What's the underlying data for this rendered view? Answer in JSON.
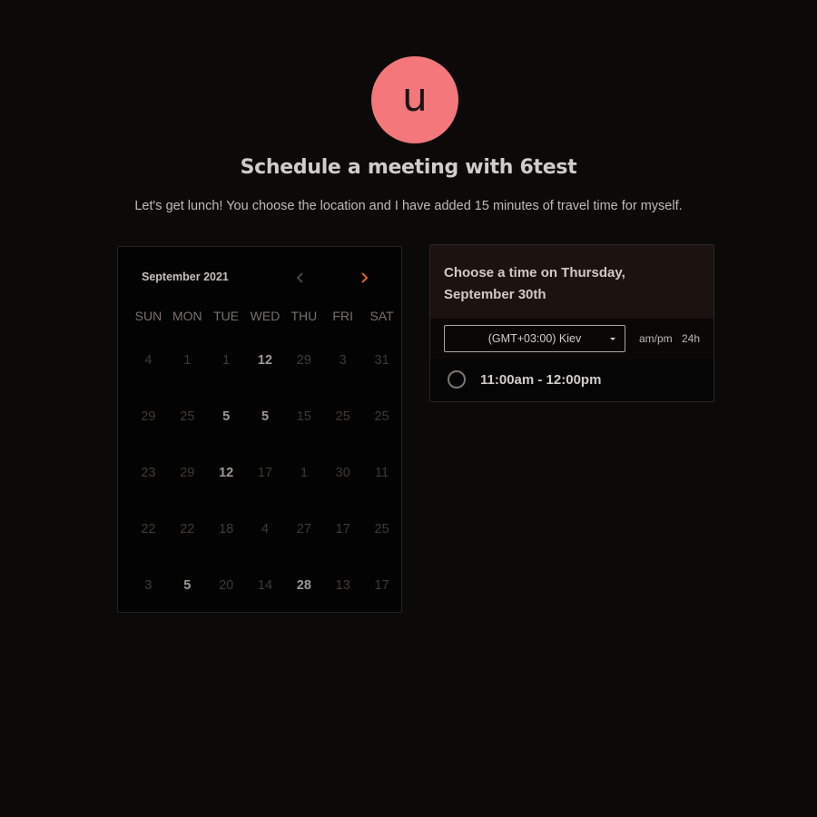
{
  "header": {
    "avatar_letter": "u",
    "avatar_color": "#f3777b",
    "title": "Schedule a meeting with 6test",
    "description": "Let's get lunch! You choose the location and I have added 15 minutes of travel time for myself."
  },
  "calendar": {
    "month_label": "September 2021",
    "prev_icon": "chevron-left-icon",
    "next_icon": "chevron-right-icon",
    "next_color": "#e0622e",
    "weekdays": [
      "SUN",
      "MON",
      "TUE",
      "WED",
      "THU",
      "FRI",
      "SAT"
    ],
    "days": [
      {
        "label": "4",
        "available": false
      },
      {
        "label": "1",
        "available": false
      },
      {
        "label": "1",
        "available": false
      },
      {
        "label": "12",
        "available": true
      },
      {
        "label": "29",
        "available": false
      },
      {
        "label": "3",
        "available": false
      },
      {
        "label": "31",
        "available": false
      },
      {
        "label": "29",
        "available": false
      },
      {
        "label": "25",
        "available": false
      },
      {
        "label": "5",
        "available": true
      },
      {
        "label": "5",
        "available": true
      },
      {
        "label": "15",
        "available": false
      },
      {
        "label": "25",
        "available": false
      },
      {
        "label": "25",
        "available": false
      },
      {
        "label": "23",
        "available": false
      },
      {
        "label": "29",
        "available": false
      },
      {
        "label": "12",
        "available": true
      },
      {
        "label": "17",
        "available": false
      },
      {
        "label": "1",
        "available": false
      },
      {
        "label": "30",
        "available": false
      },
      {
        "label": "11",
        "available": false
      },
      {
        "label": "22",
        "available": false
      },
      {
        "label": "22",
        "available": false
      },
      {
        "label": "18",
        "available": false
      },
      {
        "label": "4",
        "available": false
      },
      {
        "label": "27",
        "available": false
      },
      {
        "label": "17",
        "available": false
      },
      {
        "label": "25",
        "available": false
      },
      {
        "label": "3",
        "available": false
      },
      {
        "label": "5",
        "available": true
      },
      {
        "label": "20",
        "available": false
      },
      {
        "label": "14",
        "available": false
      },
      {
        "label": "28",
        "available": true
      },
      {
        "label": "13",
        "available": false
      },
      {
        "label": "17",
        "available": false
      }
    ]
  },
  "time_panel": {
    "heading": "Choose a time on Thursday, September 30th",
    "timezone": "(GMT+03:00) Kiev",
    "format_ampm": "am/pm",
    "format_24h": "24h",
    "slots": [
      {
        "label": "11:00am - 12:00pm",
        "selected": false
      }
    ]
  }
}
